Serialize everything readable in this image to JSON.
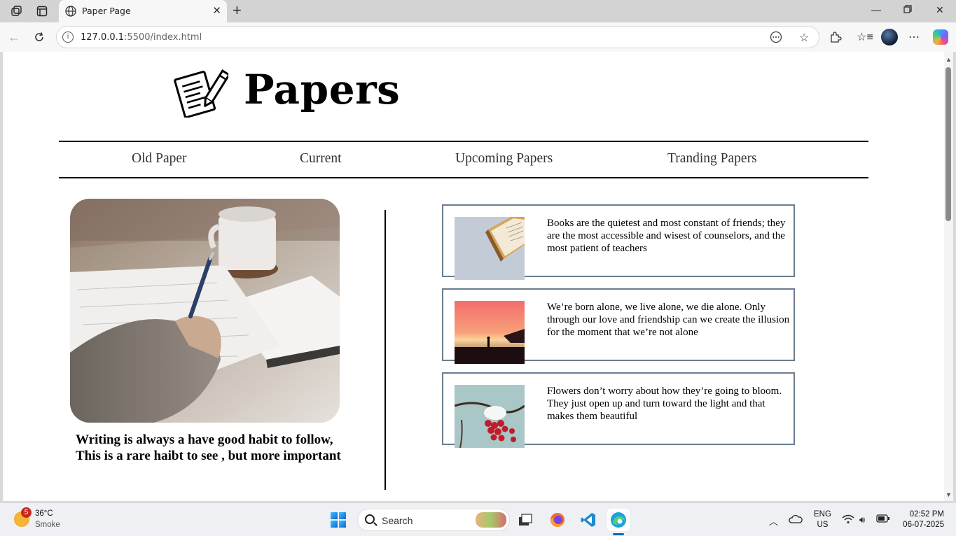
{
  "browser": {
    "tab_title": "Paper Page",
    "url_host": "127.0.0.1",
    "url_rest": ":5500/index.html"
  },
  "page": {
    "brand": "Papers",
    "menu": [
      "Old Paper",
      "Current",
      "Upcoming Papers",
      "Tranding Papers"
    ],
    "hero_caption": "Writing is always a have good habit to follow, This is a rare haibt to see , but more important",
    "cards": [
      {
        "text": "Books are the quietest and most constant of friends; they are the most accessible and wisest of counselors, and the most patient of teachers"
      },
      {
        "text": "We’re born alone, we live alone, we die alone. Only through our love and friendship can we create the illusion for the moment that we’re not alone"
      },
      {
        "text": "Flowers don’t worry about how they’re going to bloom. They just open up and turn toward the light and that makes them beautiful"
      }
    ]
  },
  "taskbar": {
    "weather_badge": "5",
    "weather_temp": "36°C",
    "weather_desc": "Smoke",
    "search_label": "Search",
    "lang_1": "ENG",
    "lang_2": "US",
    "time": "02:52 PM",
    "date": "06-07-2025"
  },
  "colors": {
    "card_border": "#6b7d8f",
    "menu_text": "#333333"
  }
}
